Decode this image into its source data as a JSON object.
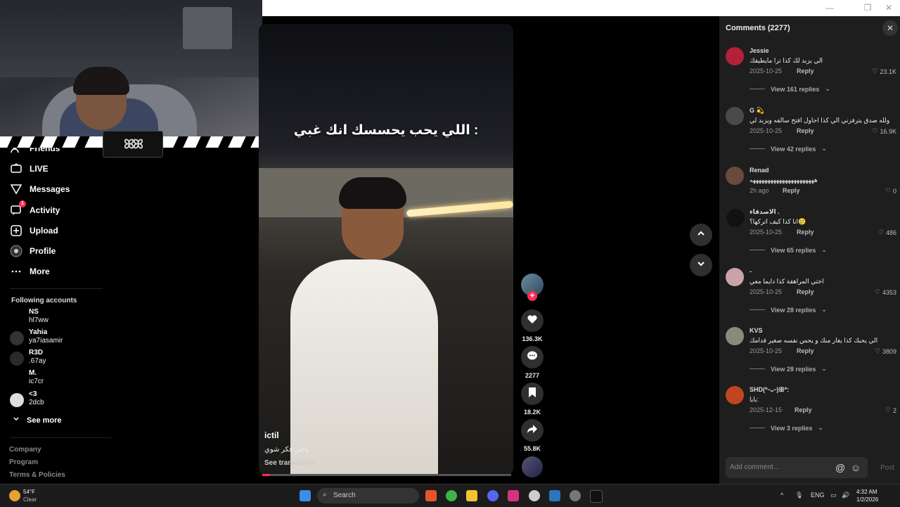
{
  "window": {
    "minimize": "—",
    "restore": "❐",
    "close": "✕"
  },
  "sidebar": {
    "nav": [
      {
        "label": "Friends",
        "icon": "friends-icon"
      },
      {
        "label": "LIVE",
        "icon": "live-icon"
      },
      {
        "label": "Messages",
        "icon": "messages-icon"
      },
      {
        "label": "Activity",
        "icon": "activity-icon",
        "badge": "1"
      },
      {
        "label": "Upload",
        "icon": "upload-icon"
      },
      {
        "label": "Profile",
        "icon": "profile-icon"
      },
      {
        "label": "More",
        "icon": "more-icon"
      }
    ],
    "following_title": "Following accounts",
    "following": [
      {
        "name": "NS",
        "handle": "hl7ww"
      },
      {
        "name": "Yahia",
        "handle": "ya7iasamir"
      },
      {
        "name": "R3D",
        "handle": ".67ay"
      },
      {
        "name": "M.",
        "handle": "ic7cr"
      },
      {
        "name": "<3",
        "handle": "2dcb"
      }
    ],
    "see_more": "See more",
    "footer": [
      "Company",
      "Program",
      "Terms & Policies"
    ]
  },
  "webcam": {
    "logo_text": "ꕤꕤ"
  },
  "video": {
    "caption": "اللي يحب يحسسك انك غبي :",
    "author": "ictil",
    "description": "ياخي فكر شوي",
    "see_translation": "See translation",
    "progress": 0.03
  },
  "actions": {
    "likes": "136.3K",
    "comments": "2277",
    "saves": "18.2K",
    "shares": "55.8K",
    "follow_plus": "+"
  },
  "comments_panel": {
    "title": "Comments (2277)",
    "close": "✕",
    "items": [
      {
        "user": "Jessie",
        "text": "الي يزبد لك كذا ترا مايطيقك",
        "date": "2025-10-25",
        "reply": "Reply",
        "likes": "23.1K",
        "view": "View 161 replies",
        "color": "#b3203a"
      },
      {
        "user": "G 💫",
        "text": "ولله صدق يترفزني الي كذا احاول افتح سالفه ويزبد لي",
        "date": "2025-10-25",
        "reply": "Reply",
        "likes": "16.9K",
        "view": "View 42 replies",
        "color": "#4a4a4a"
      },
      {
        "user": "Renad",
        "text": "ههههههههههههههههههههههه",
        "date": "2h ago",
        "reply": "Reply",
        "likes": "0",
        "view": "",
        "color": "#6a4a3c"
      },
      {
        "user": "الاصدقاء .",
        "text": "انا كذا كيف اتركها؟🥲",
        "date": "2025-10-25",
        "reply": "Reply",
        "likes": "486",
        "view": "View 65 replies",
        "color": "#111111"
      },
      {
        "user": "-",
        "text": "اختي المراهقة كذا دايما معي",
        "date": "2025-10-25",
        "reply": "Reply",
        "likes": "4353",
        "view": "View 28 replies",
        "color": "#c9a3a8"
      },
      {
        "user": "KVS",
        "text": "الي يحبك كذا يغار منك و يحس نفسه صغير قدامك",
        "date": "2025-10-25",
        "reply": "Reply",
        "likes": "3809",
        "view": "View 28 replies",
        "color": "#8a8a7a"
      },
      {
        "user": "SHD(*ᵕᴗᵕ)ꕥ*:",
        "text": "بابا:",
        "date": "2025-12-15",
        "reply": "Reply",
        "likes": "2",
        "view": "View 3 replies",
        "color": "#c2451f"
      }
    ],
    "add_placeholder": "Add comment...",
    "at_icon": "@",
    "emoji_icon": "☺",
    "post": "Post"
  },
  "taskbar": {
    "temp": "54°F",
    "condition": "Clear",
    "search": "Search",
    "lang": "ENG",
    "time": "4:32 AM",
    "date": "1/2/2026",
    "chevron": "^"
  }
}
